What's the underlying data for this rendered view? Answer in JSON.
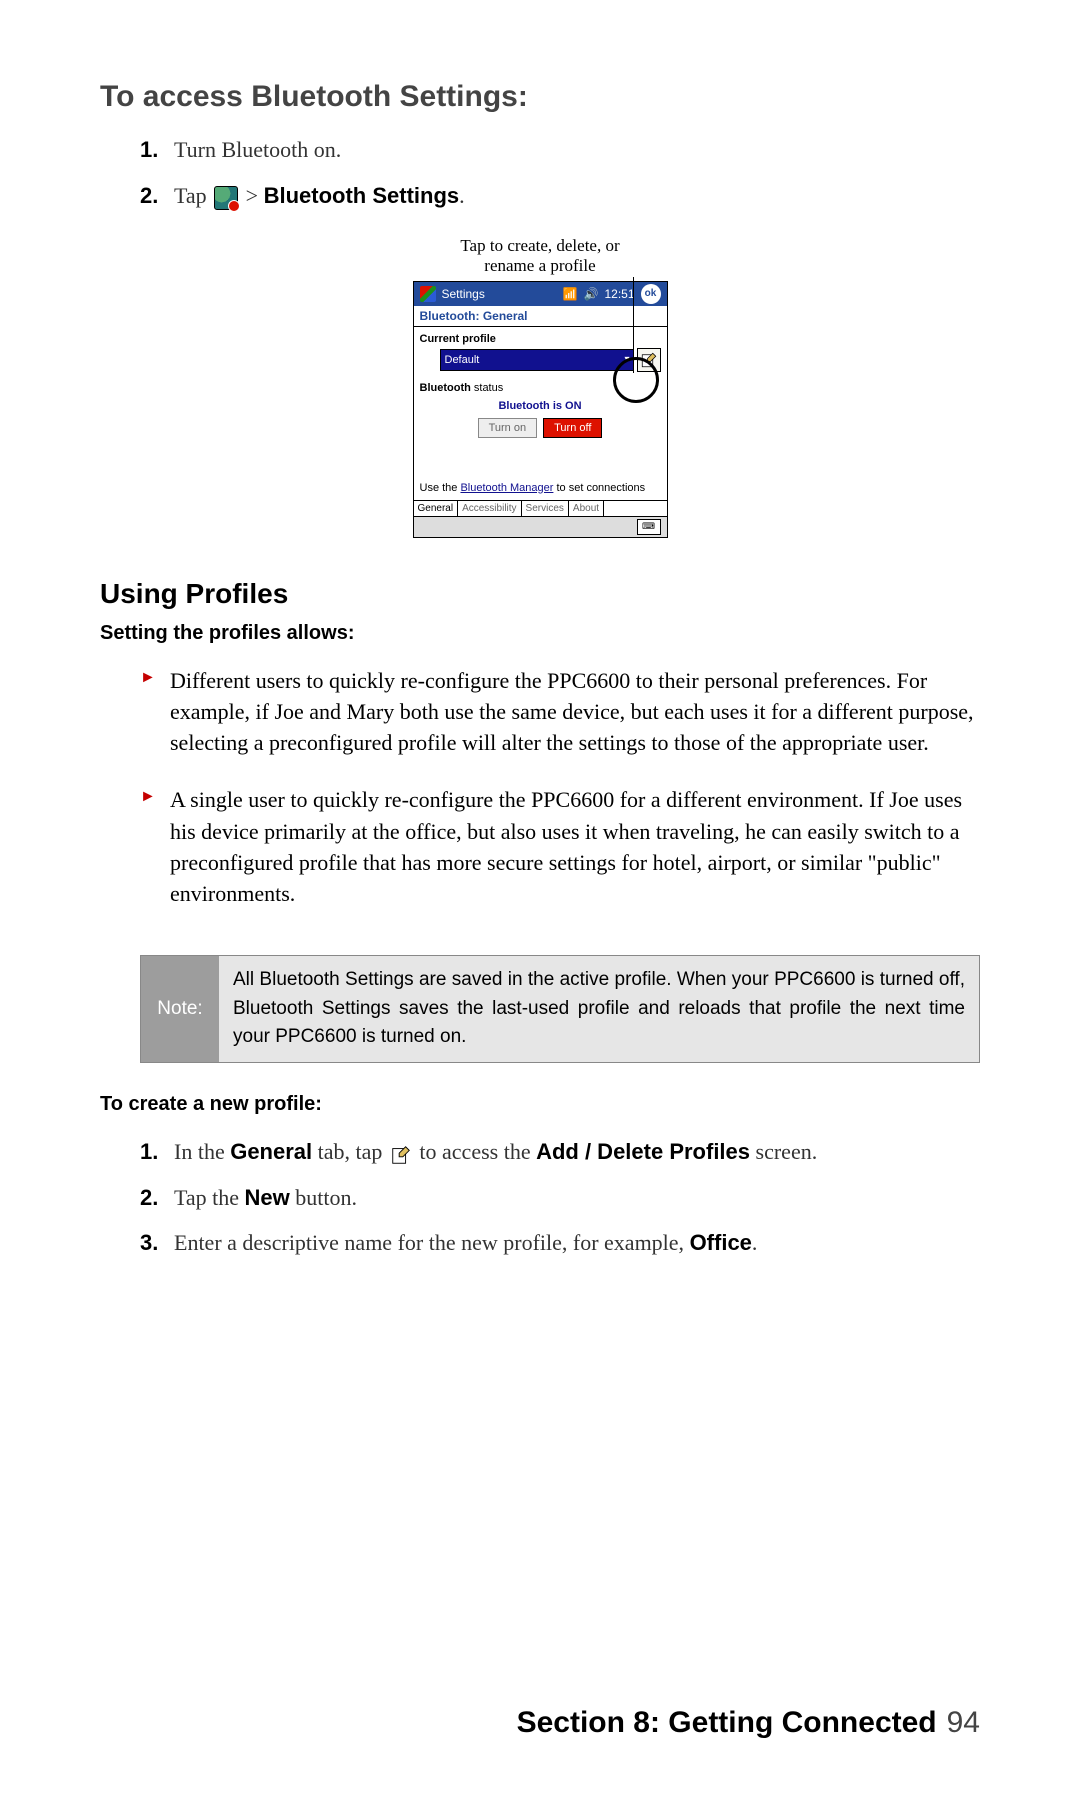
{
  "headings": {
    "access": "To access Bluetooth Settings:",
    "using_profiles": "Using Profiles",
    "setting_allows": "Setting the profiles allows:",
    "to_create": "To create a new profile:"
  },
  "steps_access": {
    "s1": "Turn Bluetooth on.",
    "s2_pre": "Tap ",
    "s2_post": " > ",
    "s2_bold": "Bluetooth Settings",
    "s2_period": "."
  },
  "figure": {
    "caption_l1": "Tap to create, delete, or",
    "caption_l2": "rename a profile"
  },
  "device": {
    "title": "Settings",
    "time": "12:51",
    "ok": "ok",
    "subtitle": "Bluetooth: General",
    "current_profile_label": "Current profile",
    "current_profile_value": "Default",
    "status_label_b": "Bluetooth",
    "status_label_rest": " status",
    "status_text": "Bluetooth is ON",
    "btn_on": "Turn on",
    "btn_off": "Turn off",
    "manager_pre": "Use the ",
    "manager_link": "Bluetooth Manager",
    "manager_post": " to set connections",
    "tabs": {
      "t1": "General",
      "t2": "Accessibility",
      "t3": "Services",
      "t4": "About"
    },
    "kbd": "⌨"
  },
  "bullets": {
    "b1": "Different users to quickly re-configure the PPC6600 to their personal preferences. For example, if Joe and Mary both use the same device, but each uses it for a different purpose, selecting a preconfigured profile will alter the settings to those of the appropriate user.",
    "b2": "A single user to quickly re-configure the PPC6600 for a different environment. If Joe uses his device primarily at the office, but also uses it when traveling, he can easily switch to a preconfigured profile that has more secure settings for hotel, airport, or similar \"public\" environments."
  },
  "note": {
    "label": "Note:",
    "text": "All Bluetooth Settings are saved in the active profile. When your PPC6600 is turned off, Bluetooth Settings saves the last-used profile and reloads that profile the next time your PPC6600 is turned on."
  },
  "steps_create": {
    "s1_pre": "In the ",
    "s1_b1": "General",
    "s1_mid": " tab, tap ",
    "s1_post": " to access the ",
    "s1_b2": "Add / Delete Profiles",
    "s1_end": " screen.",
    "s2_pre": "Tap the ",
    "s2_b": "New",
    "s2_post": " button.",
    "s3_pre": "Enter a descriptive name for the new profile, for example, ",
    "s3_b": "Office",
    "s3_post": "."
  },
  "footer": {
    "section": "Section 8: Getting Connected",
    "page": "94"
  },
  "icons": {
    "bluetooth": "bluetooth-icon",
    "profiles": "profiles-icon",
    "signal": "📶",
    "sound": "🔊"
  }
}
